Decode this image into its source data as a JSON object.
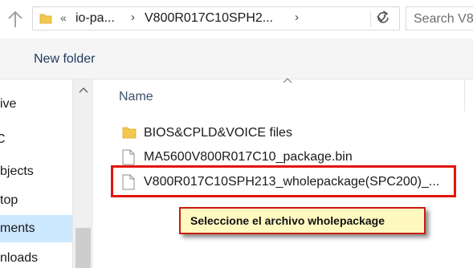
{
  "address_bar": {
    "overflow_glyph": "«",
    "crumbs": [
      "io-pa...",
      "V800R017C10SPH2..."
    ],
    "separator": "›"
  },
  "search": {
    "placeholder": "Search V8"
  },
  "command_bar": {
    "new_folder": "New folder"
  },
  "nav_pane": {
    "items": [
      {
        "label": "ive",
        "selected": false
      },
      {
        "label": "C",
        "selected": false
      },
      {
        "label": "bjects",
        "selected": false
      },
      {
        "label": "top",
        "selected": false
      },
      {
        "label": "ments",
        "selected": true
      },
      {
        "label": "nloads",
        "selected": false
      }
    ]
  },
  "file_list": {
    "column_name": "Name",
    "files": [
      {
        "name": "BIOS&CPLD&VOICE files",
        "icon": "folder-icon"
      },
      {
        "name": "MA5600V800R017C10_package.bin",
        "icon": "file-icon"
      },
      {
        "name": "V800R017C10SPH213_wholepackage(SPC200)_...",
        "icon": "file-icon"
      }
    ]
  },
  "annotation": {
    "callout_text": "Seleccione el archivo wholepackage"
  },
  "colors": {
    "highlight_border": "#e3140f",
    "callout_background": "#fff9c0",
    "selected_nav": "#cce8ff",
    "folder": "#f2c94c"
  }
}
